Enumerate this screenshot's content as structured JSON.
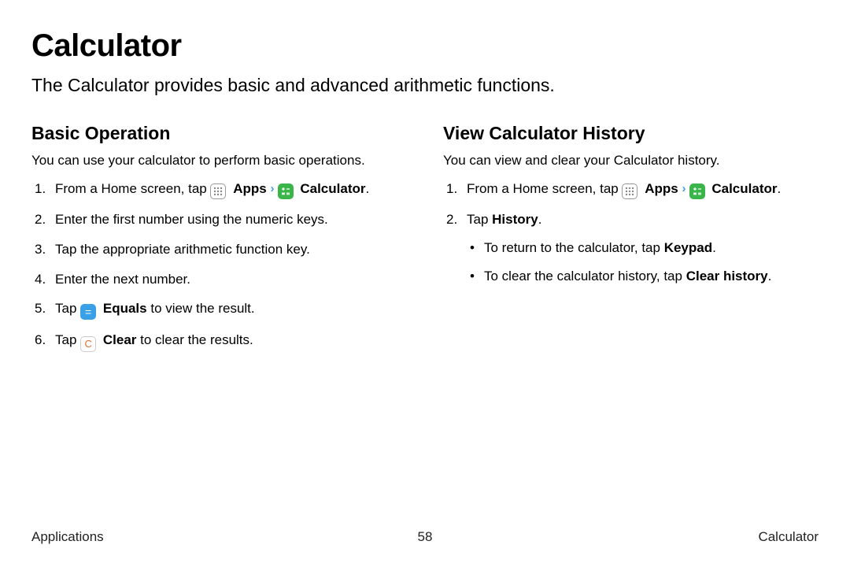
{
  "title": "Calculator",
  "intro": "The Calculator provides basic and advanced arithmetic functions.",
  "left": {
    "heading": "Basic Operation",
    "desc": "You can use your calculator to perform basic operations.",
    "step1_a": "From a Home screen, tap ",
    "apps_label": "Apps",
    "calc_label": "Calculator",
    "step2": "Enter the first number using the numeric keys.",
    "step3": "Tap the appropriate arithmetic function key.",
    "step4": "Enter the next number.",
    "step5_a": "Tap ",
    "equals_glyph": "=",
    "equals_label": "Equals",
    "step5_b": " to view the result.",
    "step6_a": "Tap ",
    "clear_glyph": "C",
    "clear_label": "Clear",
    "step6_b": " to clear the results."
  },
  "right": {
    "heading": "View Calculator History",
    "desc": "You can view and clear your Calculator history.",
    "step1_a": "From a Home screen, tap ",
    "apps_label": "Apps",
    "calc_label": "Calculator",
    "step2_a": "Tap ",
    "history_label": "History",
    "step2_b": ".",
    "bullet1_a": "To return to the calculator, tap ",
    "keypad_label": "Keypad",
    "bullet1_b": ".",
    "bullet2_a": "To clear the calculator history, tap ",
    "clearhistory_label": "Clear history",
    "bullet2_b": "."
  },
  "footer": {
    "left": "Applications",
    "center": "58",
    "right": "Calculator"
  }
}
